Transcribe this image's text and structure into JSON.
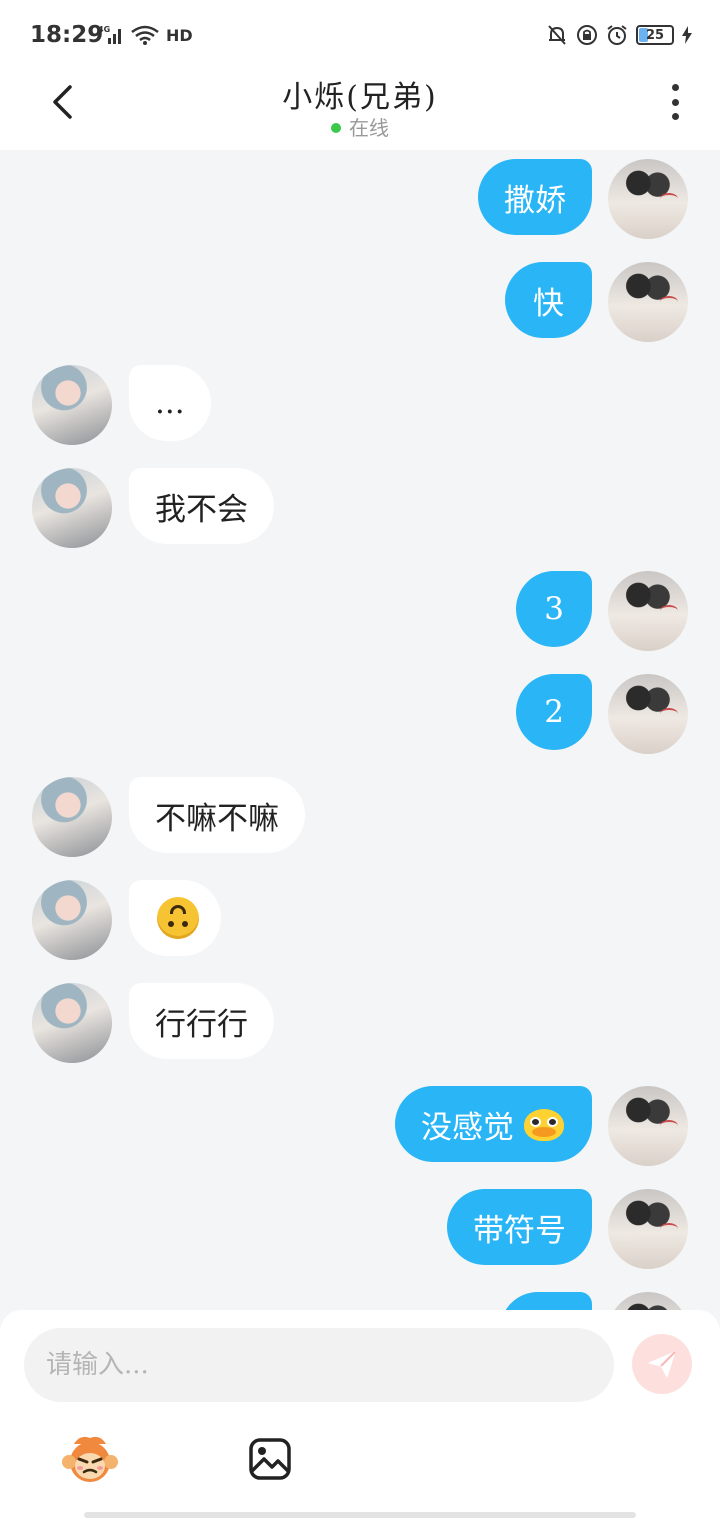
{
  "status_bar": {
    "time": "18:29",
    "network": "4G",
    "hd": "HD",
    "battery": "25"
  },
  "header": {
    "title": "小烁(兄弟)",
    "status": "在线",
    "online_color": "#3ac94b"
  },
  "messages": [
    {
      "side": "right",
      "text": "撒娇"
    },
    {
      "side": "right",
      "text": "快"
    },
    {
      "side": "left",
      "text": "..."
    },
    {
      "side": "left",
      "text": "我不会"
    },
    {
      "side": "right",
      "text": "3"
    },
    {
      "side": "right",
      "text": "2"
    },
    {
      "side": "left",
      "text": "不嘛不嘛"
    },
    {
      "side": "left",
      "text": "",
      "emoji": "upside-down-face"
    },
    {
      "side": "left",
      "text": "行行行"
    },
    {
      "side": "right",
      "text": "没感觉",
      "emoji": "duck-sticker"
    },
    {
      "side": "right",
      "text": "带符号"
    },
    {
      "side": "right",
      "text": ""
    }
  ],
  "composer": {
    "placeholder": "请输入..."
  },
  "colors": {
    "my_bubble": "#29b5f6",
    "their_bubble": "#ffffff",
    "send_button": "#fde0de"
  }
}
